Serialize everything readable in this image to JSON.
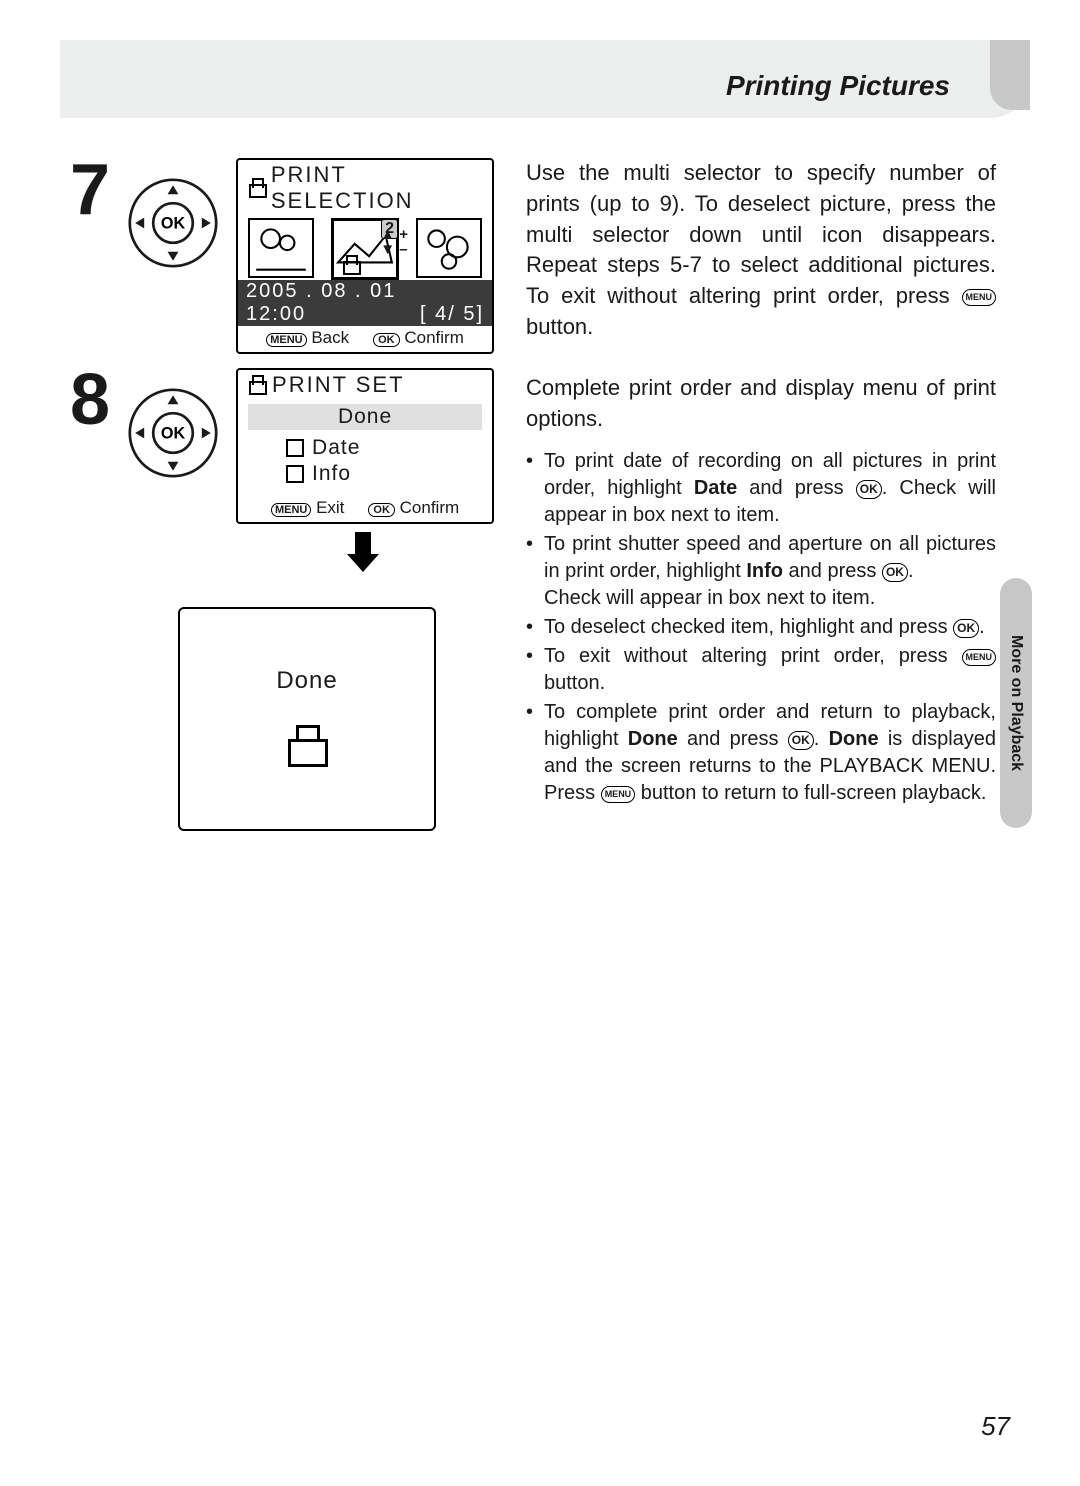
{
  "header": {
    "title": "Printing Pictures"
  },
  "sidetab": "More on Playback",
  "page_number": "57",
  "step7": {
    "number": "7",
    "screen": {
      "title": "PRINT SELECTION",
      "date": "2005 . 08 . 01",
      "time": "12:00",
      "counter": "4/      5",
      "count_badge": "2",
      "footer_back": "Back",
      "footer_confirm": "Confirm",
      "menu_label": "MENU",
      "ok_label": "OK"
    },
    "text": "Use the multi selector to specify number of prints (up to 9). To deselect picture, press the multi selector down until icon disappears. Repeat steps 5-7 to select additional pictures. To exit without altering print order, press "
  },
  "step7_text2": " button.",
  "step8": {
    "number": "8",
    "screen": {
      "title": "PRINT SET",
      "done": "Done",
      "date_label": "Date",
      "info_label": "Info",
      "footer_exit": "Exit",
      "footer_confirm": "Confirm",
      "menu_label": "MENU",
      "ok_label": "OK"
    },
    "screen3_done": "Done",
    "intro": "Complete print order and display menu of print options.",
    "b1a": "To print date of recording on all pictures in print order, highlight ",
    "b1b": "Date",
    "b1c": " and press ",
    "b1d": ". Check will appear in box next to item.",
    "b2a": "To print shutter speed and aperture on all pictures in print order, highlight ",
    "b2b": "Info",
    "b2c": " and press ",
    "b2d": ".",
    "b2e": "Check will appear in box next to item.",
    "b3a": "To deselect checked item, highlight and press ",
    "b3b": ".",
    "b4a": "To exit without altering print order, press ",
    "b4b": " button.",
    "b5a": "To complete print order and return to playback, highlight ",
    "b5b": "Done",
    "b5c": " and press ",
    "b5d": ". ",
    "b5e": "Done",
    "b5f": " is displayed and the screen returns to the PLAYBACK MENU. Press ",
    "b5g": " button to return to full-screen playback."
  },
  "icons": {
    "ok": "OK",
    "menu": "MENU"
  }
}
